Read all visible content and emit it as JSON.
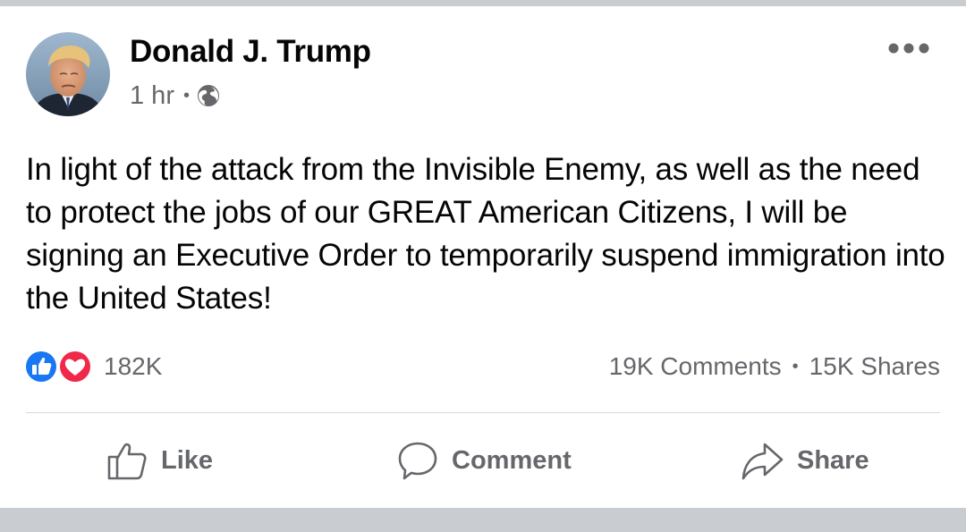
{
  "post": {
    "author_name": "Donald J. Trump",
    "timestamp": "1 hr",
    "meta_separator": "•",
    "privacy_icon": "globe-icon",
    "more_icon": "more-options-icon",
    "text": "In light of the attack from the Invisible Enemy, as well as the need to protect the jobs of our GREAT American Citizens, I will be signing an Executive Order to temporarily suspend immigration into the United States!"
  },
  "engagement": {
    "reaction_icons": [
      "like-reaction-icon",
      "love-reaction-icon"
    ],
    "reaction_count": "182K",
    "comments": "19K Comments",
    "separator": "•",
    "shares": "15K Shares"
  },
  "actions": {
    "like_label": "Like",
    "comment_label": "Comment",
    "share_label": "Share"
  },
  "colors": {
    "text_primary": "#050505",
    "text_secondary": "#65676b",
    "like_blue": "#1877f2",
    "love_red": "#f02849",
    "band_gray": "#c9ccd1"
  }
}
